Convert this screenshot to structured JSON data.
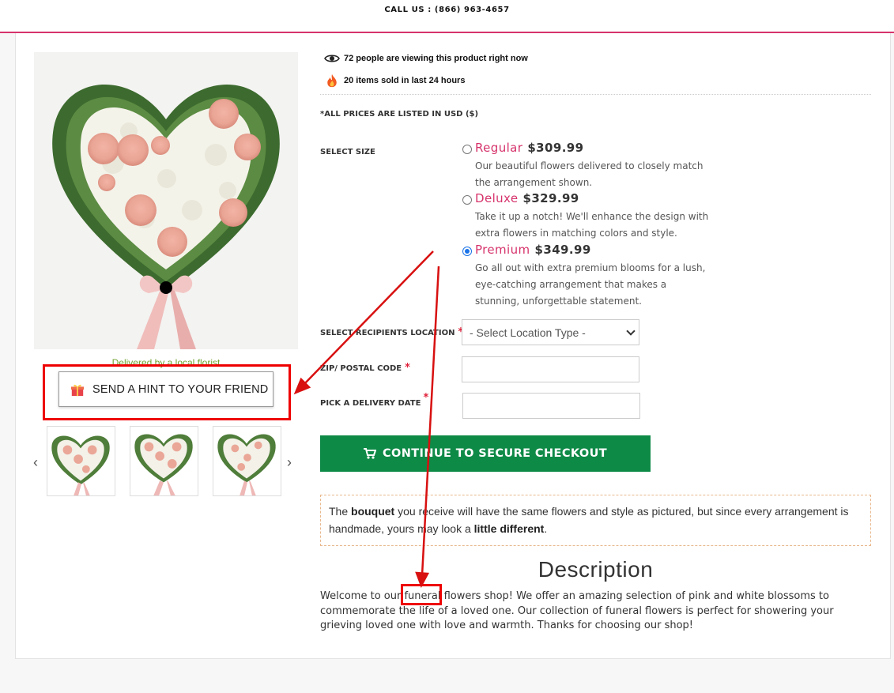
{
  "header": {
    "call_us": "CALL US : (866) 963-4657"
  },
  "gallery": {
    "local_florist_text": "Delivered by a local florist",
    "hint_button_label": "SEND A HINT TO YOUR FRIEND",
    "prev_icon": "chevron-left-icon",
    "next_icon": "chevron-right-icon"
  },
  "social_proof": {
    "viewers": "72 people are viewing this product right now",
    "sold": "20 items sold in last 24 hours"
  },
  "prices_note": "*ALL PRICES ARE LISTED IN USD ($)",
  "size": {
    "label": "SELECT SIZE",
    "options": [
      {
        "name": "Regular",
        "price": "$309.99",
        "desc": "Our beautiful flowers delivered to closely match the arrangement shown.",
        "selected": false
      },
      {
        "name": "Deluxe",
        "price": "$329.99",
        "desc": "Take it up a notch! We'll enhance the design with extra flowers in matching colors and style.",
        "selected": false
      },
      {
        "name": "Premium",
        "price": "$349.99",
        "desc": "Go all out with extra premium blooms for a lush, eye-catching arrangement that makes a stunning, unforgettable statement.",
        "selected": true
      }
    ]
  },
  "location": {
    "label": "SELECT RECIPIENTS LOCATION",
    "required": "*",
    "selected": "- Select Location Type -"
  },
  "zip": {
    "label": "ZIP/ POSTAL CODE",
    "required": "*",
    "value": ""
  },
  "date": {
    "label": "PICK A DELIVERY DATE",
    "required": "*",
    "value": ""
  },
  "checkout": {
    "label": "CONTINUE TO SECURE CHECKOUT"
  },
  "note": {
    "t1": "The ",
    "b1": "bouquet",
    "t2": " you receive will have the same flowers and style as pictured, but since every arrangement is handmade, yours may look a ",
    "b2": "little different",
    "t3": "."
  },
  "description": {
    "title": "Description",
    "t1": "Welcome to our ",
    "highlight": "funeral",
    "t2": " flowers shop! We offer an amazing selection of pink and white blossoms to commemorate the life of a loved one. Our collection of funeral flowers is perfect for showering your grieving loved one with love and warmth. Thanks for choosing our shop!"
  },
  "colors": {
    "accent": "#d6336c",
    "checkout": "#0e8a47",
    "annotation": "#e00000"
  }
}
